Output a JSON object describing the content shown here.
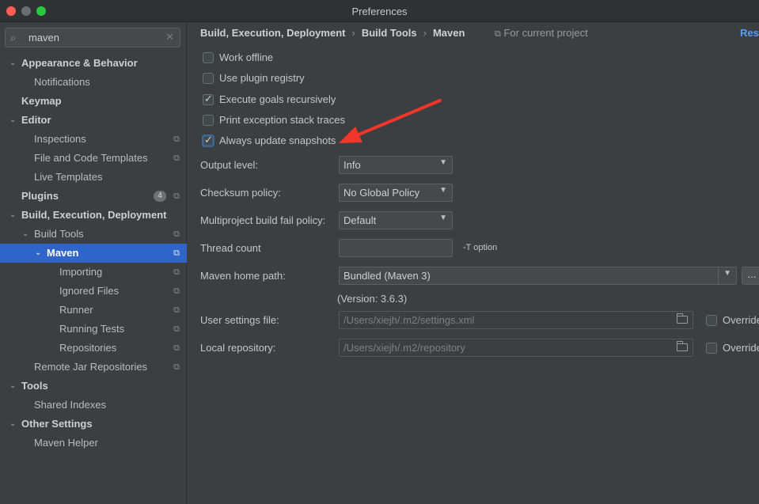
{
  "window": {
    "title": "Preferences"
  },
  "search": {
    "value": "maven",
    "icon": "search-icon",
    "clear_icon": "clear-icon"
  },
  "sidebar": {
    "items": [
      {
        "label": "Appearance & Behavior",
        "bold": true,
        "expandable": true,
        "expanded": true
      },
      {
        "label": "Notifications"
      },
      {
        "label": "Keymap",
        "bold": true
      },
      {
        "label": "Editor",
        "bold": true,
        "expandable": true,
        "expanded": true
      },
      {
        "label": "Inspections",
        "project": true
      },
      {
        "label": "File and Code Templates",
        "project": true
      },
      {
        "label": "Live Templates"
      },
      {
        "label": "Plugins",
        "bold": true,
        "badge": "4",
        "project": true
      },
      {
        "label": "Build, Execution, Deployment",
        "bold": true,
        "expandable": true,
        "expanded": true
      },
      {
        "label": "Build Tools",
        "expandable": true,
        "expanded": true,
        "project": true
      },
      {
        "label": "Maven",
        "expandable": true,
        "expanded": true,
        "project": true,
        "selected": true
      },
      {
        "label": "Importing",
        "project": true
      },
      {
        "label": "Ignored Files",
        "project": true
      },
      {
        "label": "Runner",
        "project": true
      },
      {
        "label": "Running Tests",
        "project": true
      },
      {
        "label": "Repositories",
        "project": true
      },
      {
        "label": "Remote Jar Repositories",
        "project": true
      },
      {
        "label": "Tools",
        "bold": true,
        "expandable": true,
        "expanded": true
      },
      {
        "label": "Shared Indexes"
      },
      {
        "label": "Other Settings",
        "bold": true,
        "expandable": true,
        "expanded": true
      },
      {
        "label": "Maven Helper"
      }
    ]
  },
  "breadcrumb": {
    "items": [
      "Build, Execution, Deployment",
      "Build Tools",
      "Maven"
    ],
    "separator": "›",
    "scope": "For current project",
    "reset": "Res"
  },
  "checkboxes": {
    "work_offline": {
      "label": "Work offline",
      "checked": false
    },
    "use_plugin_registry": {
      "label": "Use plugin registry",
      "checked": false
    },
    "execute_goals_recursively": {
      "label": "Execute goals recursively",
      "checked": true
    },
    "print_exception_stack_traces": {
      "label": "Print exception stack traces",
      "checked": false
    },
    "always_update_snapshots": {
      "label": "Always update snapshots",
      "checked": true
    }
  },
  "fields": {
    "output_level": {
      "label": "Output level:",
      "value": "Info"
    },
    "checksum_policy": {
      "label": "Checksum policy:",
      "value": "No Global Policy"
    },
    "multiproject_fail_policy": {
      "label": "Multiproject build fail policy:",
      "value": "Default"
    },
    "thread_count": {
      "label": "Thread count",
      "value": "",
      "hint": "-T option"
    },
    "maven_home": {
      "label": "Maven home path:",
      "value": "Bundled (Maven 3)",
      "browse": "...",
      "version": "(Version: 3.6.3)"
    },
    "user_settings": {
      "label": "User settings file:",
      "value": "/Users/xiejh/.m2/settings.xml",
      "override": "Override",
      "override_checked": false
    },
    "local_repository": {
      "label": "Local repository:",
      "value": "/Users/xiejh/.m2/repository",
      "override": "Override",
      "override_checked": false
    }
  },
  "colors": {
    "background": "#3c3f41",
    "selection": "#2f65ca",
    "link": "#589df6",
    "annotation": "#f2362b"
  }
}
